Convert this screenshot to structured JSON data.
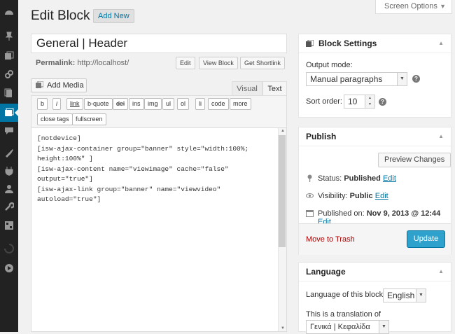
{
  "header": {
    "title": "Edit Block",
    "add_new": "Add New",
    "screen_options": "Screen Options"
  },
  "post": {
    "title": "General | Header",
    "permalink_label": "Permalink:",
    "permalink_url": "http://localhost/",
    "buttons": {
      "edit": "Edit",
      "view": "View Block",
      "shortlink": "Get Shortlink"
    }
  },
  "editor": {
    "add_media": "Add Media",
    "tabs": {
      "visual": "Visual",
      "text": "Text"
    },
    "quicktags_row1": [
      "b",
      "i",
      "link",
      "b-quote",
      "del",
      "ins",
      "img",
      "ul",
      "ol",
      "li",
      "code",
      "more"
    ],
    "quicktags_row2": [
      "close tags",
      "fullscreen"
    ],
    "content": "[notdevice]\n[isw-ajax-container group=\"banner\" style=\"width:100%; height:100%\" ]\n[isw-ajax-content name=\"viewimage\" cache=\"false\" output=\"true\"]\n[isw-ajax-link group=\"banner\" name=\"viewvideo\" autoload=\"true\"]"
  },
  "block_settings": {
    "title": "Block Settings",
    "output_mode_label": "Output mode:",
    "output_mode_value": "Manual paragraphs",
    "sort_order_label": "Sort order:",
    "sort_order_value": "10"
  },
  "publish": {
    "title": "Publish",
    "preview": "Preview Changes",
    "status_label": "Status:",
    "status_value": "Published",
    "visibility_label": "Visibility:",
    "visibility_value": "Public",
    "published_label": "Published on:",
    "published_value": "Nov 9, 2013 @ 12:44",
    "edit": "Edit",
    "trash": "Move to Trash",
    "update": "Update"
  },
  "language": {
    "title": "Language",
    "lang_label": "Language of this block",
    "lang_value": "English",
    "translation_label": "This is a translation of",
    "translation_value": "Γενικά | Κεφαλίδα"
  },
  "colors": {
    "sidebar": "#222222",
    "accent": "#0074a2",
    "update_button": "#2ea2cc",
    "trash": "#a00000"
  },
  "sidebar_icons": [
    "dashboard-icon",
    "pin-icon",
    "media-icon",
    "links-icon",
    "pages-icon",
    "blocks-icon",
    "comments-icon",
    "appearance-icon",
    "plugins-icon",
    "users-icon",
    "tools-icon",
    "settings-icon",
    "spinner-icon",
    "play-icon"
  ]
}
